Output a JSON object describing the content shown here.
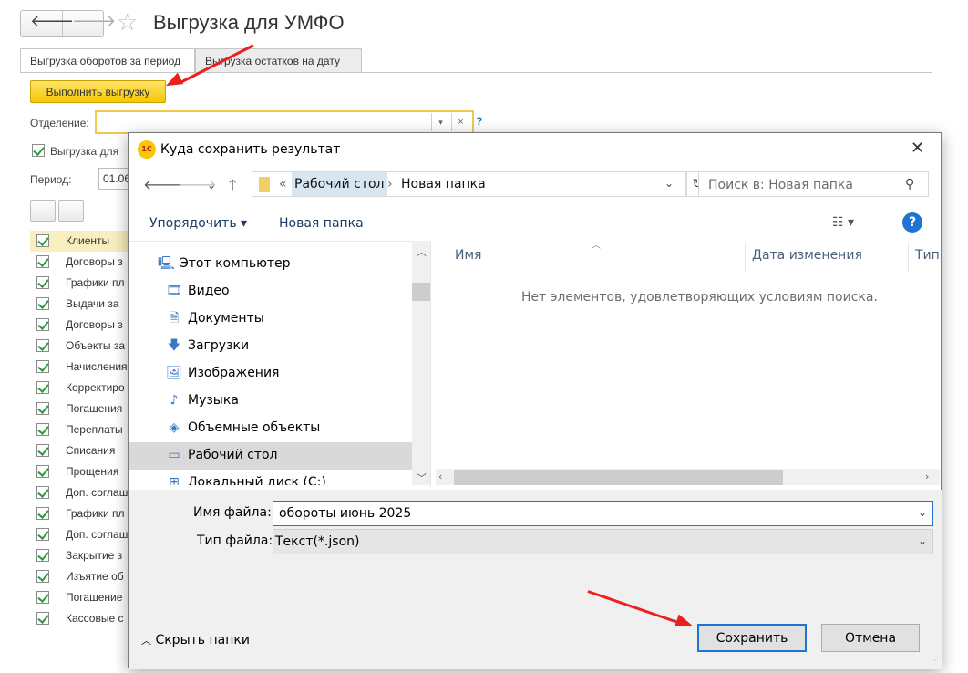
{
  "window": {
    "title": "Выгрузка для УМФО",
    "back_glyph": "🡐",
    "forward_glyph": "🡒",
    "star_glyph": "☆"
  },
  "tabs": [
    {
      "label": "Выгрузка оборотов за период",
      "active": true
    },
    {
      "label": "Выгрузка остатков на дату",
      "active": false
    }
  ],
  "form": {
    "run_button": "Выполнить выгрузку",
    "department_label": "Отделение:",
    "department_value": "",
    "help_glyph": "?",
    "export_checkbox_label": "Выгрузка для",
    "period_label": "Период:",
    "period_value": "01.06"
  },
  "objects": [
    "Клиенты",
    "Договоры з",
    "Графики пл",
    "Выдачи за",
    "Договоры з",
    "Объекты за",
    "Начисления",
    "Корректиро",
    "Погашения",
    "Переплаты",
    "Списания",
    "Прощения",
    "Доп. соглаш",
    "Графики пл",
    "Доп. соглаш",
    "Закрытие з",
    "Изъятие об",
    "Погашение",
    "Кассовые с"
  ],
  "dialog": {
    "title": "Куда сохранить результат",
    "logo_text": "1С",
    "close_glyph": "✕",
    "address": {
      "sep": "«",
      "crumbs": [
        "Рабочий стол",
        "Новая папка"
      ]
    },
    "search_placeholder": "Поиск в: Новая папка",
    "toolbar": {
      "organize": "Упорядочить ▾",
      "new_folder": "Новая папка",
      "help": "?"
    },
    "tree": [
      {
        "label": "Этот компьютер",
        "icon": "computer-icon",
        "glyph": "🖳",
        "root": true
      },
      {
        "label": "Видео",
        "icon": "video-icon",
        "glyph": "🎞"
      },
      {
        "label": "Документы",
        "icon": "documents-icon",
        "glyph": "🗎"
      },
      {
        "label": "Загрузки",
        "icon": "downloads-icon",
        "glyph": "🡇"
      },
      {
        "label": "Изображения",
        "icon": "images-icon",
        "glyph": "🖼"
      },
      {
        "label": "Музыка",
        "icon": "music-icon",
        "glyph": "♪"
      },
      {
        "label": "Объемные объекты",
        "icon": "3d-objects-icon",
        "glyph": "◈"
      },
      {
        "label": "Рабочий стол",
        "icon": "desktop-icon",
        "glyph": "▭",
        "selected": true
      },
      {
        "label": "Локальный диск (C:)",
        "icon": "drive-icon",
        "glyph": "⊞"
      }
    ],
    "columns": [
      "Имя",
      "Дата изменения",
      "Тип"
    ],
    "empty_message": "Нет элементов, удовлетворяющих условиям поиска.",
    "file_name_label": "Имя файла:",
    "file_name_value": "обороты июнь 2025",
    "file_type_label": "Тип файла:",
    "file_type_value": "Текст(*.json)",
    "hide_folders": "Скрыть папки",
    "save_button": "Сохранить",
    "cancel_button": "Отмена"
  },
  "colors": {
    "accent_yellow": "#f6c800",
    "arrow_red": "#e8201e",
    "dialog_blue": "#1e74d0"
  }
}
